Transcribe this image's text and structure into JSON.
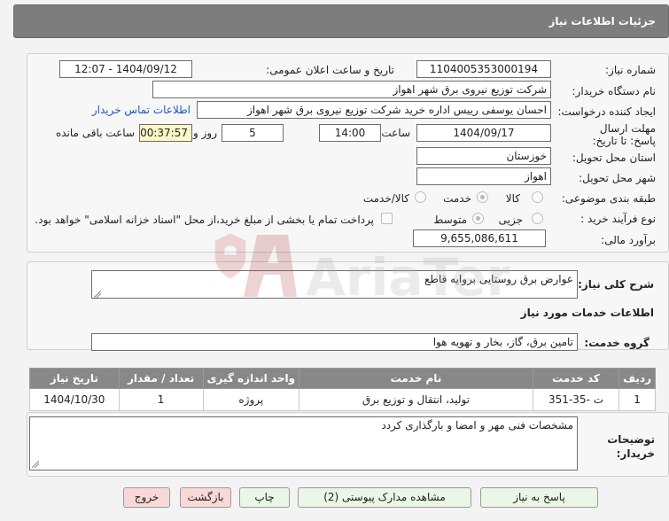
{
  "header": {
    "title": "جزئیات اطلاعات نیاز"
  },
  "fields": {
    "need_number_label": "شماره نیاز:",
    "need_number": "1104005353000194",
    "announce_label": "تاریخ و ساعت اعلان عمومی:",
    "announce_value": "1404/09/12 - 12:07",
    "buyer_org_label": "نام دستگاه خریدار:",
    "buyer_org": "شرکت توزیع نیروی برق شهر اهواز",
    "creator_label": "ایجاد کننده درخواست:",
    "creator": "احسان یوسفی رییس اداره خرید شرکت توزیع نیروی برق شهر اهواز",
    "contact_link": "اطلاعات تماس خریدار",
    "deadline_label": "مهلت ارسال پاسخ: تا تاریخ:",
    "deadline_date": "1404/09/17",
    "time_label": "ساعت",
    "deadline_time": "14:00",
    "days_value": "5",
    "days_label": "روز و",
    "remaining_time": "00:37:57",
    "remaining_label": "ساعت باقی مانده",
    "province_label": "استان محل تحویل:",
    "province": "خوزستان",
    "city_label": "شهر محل تحویل:",
    "city": "اهواز",
    "category_label": "طبقه بندی موضوعی:",
    "category_options": [
      "کالا",
      "خدمت",
      "کالا/خدمت"
    ],
    "category_selected": "خدمت",
    "process_label": "نوع فرآیند خرید :",
    "process_options": [
      "جزیی",
      "متوسط"
    ],
    "process_selected": "متوسط",
    "payment_note": "پرداخت تمام یا بخشی از مبلغ خرید،از محل \"اسناد خزانه اسلامی\" خواهد بود.",
    "budget_label": "برآورد مالی:",
    "budget": "9,655,086,611"
  },
  "description": {
    "label": "شرح کلی نیاز:",
    "value": "عوارض برق روستایی بروایه قاطع"
  },
  "services": {
    "section_title": "اطلاعات خدمات مورد نیاز",
    "group_label": "گروه خدمت:",
    "group_value": "تامین برق، گاز، بخار و تهویه هوا",
    "columns": [
      "ردیف",
      "کد خدمت",
      "نام خدمت",
      "واحد اندازه گیری",
      "تعداد / مقدار",
      "تاریخ نیاز"
    ],
    "rows": [
      [
        "1",
        "ت -35-351",
        "تولید، انتقال و توزیع برق",
        "پروژه",
        "1",
        "1404/10/30"
      ]
    ]
  },
  "buyer_notes": {
    "label": "توضیحات خریدار:",
    "value": "مشخصات فنی مهر و امضا و بارگذاری کردد"
  },
  "buttons": {
    "reply": "پاسخ به نیاز",
    "attachments": "مشاهده مدارک پیوستی (2)",
    "print": "چاپ",
    "back": "بازگشت",
    "exit": "خروج"
  },
  "watermark": {
    "text": "AriaTender.neT"
  },
  "colors": {
    "header_bg": "#7d7d7d",
    "link": "#1a58b8",
    "highlight": "#fdf6c7",
    "table_header": "#888888"
  }
}
